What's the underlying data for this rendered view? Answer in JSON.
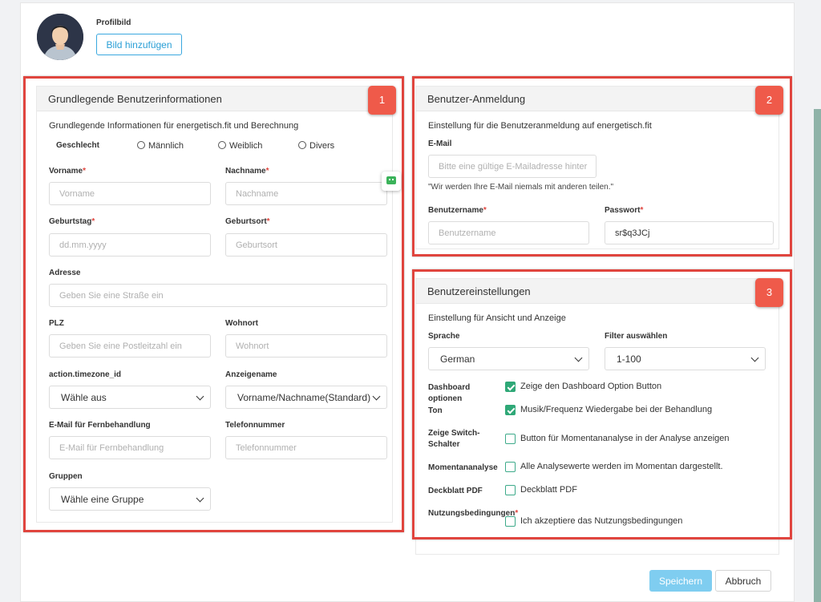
{
  "profile": {
    "label": "Profilbild",
    "add_button": "Bild hinzufügen"
  },
  "section1": {
    "badge": "1",
    "title": "Grundlegende Benutzerinformationen",
    "description": "Grundlegende Informationen für energetisch.fit und Berechnung",
    "gender": {
      "label": "Geschlecht",
      "options": [
        "Männlich",
        "Weiblich",
        "Divers"
      ]
    },
    "vorname": {
      "label": "Vorname",
      "placeholder": "Vorname"
    },
    "nachname": {
      "label": "Nachname",
      "placeholder": "Nachname"
    },
    "geburtstag": {
      "label": "Geburtstag",
      "placeholder": "dd.mm.yyyy"
    },
    "geburtsort": {
      "label": "Geburtsort",
      "placeholder": "Geburtsort"
    },
    "adresse": {
      "label": "Adresse",
      "placeholder": "Geben Sie eine Straße ein"
    },
    "plz": {
      "label": "PLZ",
      "placeholder": "Geben Sie eine Postleitzahl ein"
    },
    "wohnort": {
      "label": "Wohnort",
      "placeholder": "Wohnort"
    },
    "timezone": {
      "label": "action.timezone_id",
      "value": "Wähle aus"
    },
    "anzeigename": {
      "label": "Anzeigename",
      "value": "Vorname/Nachname(Standard)"
    },
    "fernbehandlung": {
      "label": "E-Mail für Fernbehandlung",
      "placeholder": "E-Mail für Fernbehandlung"
    },
    "telefon": {
      "label": "Telefonnummer",
      "placeholder": "Telefonnummer"
    },
    "gruppen": {
      "label": "Gruppen",
      "value": "Wähle eine Gruppe"
    }
  },
  "section2": {
    "badge": "2",
    "title": "Benutzer-Anmeldung",
    "description": "Einstellung für die Benutzeranmeldung auf energetisch.fit",
    "email": {
      "label": "E-Mail",
      "placeholder": "Bitte eine gültige E-Mailadresse hinter",
      "note": "\"Wir werden Ihre E-Mail niemals mit anderen teilen.\""
    },
    "benutzername": {
      "label": "Benutzername",
      "placeholder": "Benutzername"
    },
    "passwort": {
      "label": "Passwort",
      "value": "sr$q3JCj"
    }
  },
  "section3": {
    "badge": "3",
    "title": "Benutzereinstellungen",
    "description": "Einstellung für Ansicht und Anzeige",
    "sprache": {
      "label": "Sprache",
      "value": "German"
    },
    "filter": {
      "label": "Filter auswählen",
      "value": "1-100"
    },
    "settings": [
      {
        "label": "Dashboard optionen",
        "text": "Zeige den Dashboard Option Button",
        "checked": true
      },
      {
        "label": "Ton",
        "text": "Musik/Frequenz Wiedergabe bei der Behandlung",
        "checked": true
      },
      {
        "label": "Zeige Switch-Schalter",
        "text": "Button für Momentananalyse in der Analyse anzeigen",
        "checked": false
      },
      {
        "label": "Momentananalyse",
        "text": "Alle Analysewerte werden im Momentan dargestellt.",
        "checked": false
      },
      {
        "label": "Deckblatt PDF",
        "text": "Deckblatt PDF",
        "checked": false
      },
      {
        "label": "Nutzungsbedingungen",
        "text": "Ich akzeptiere das Nutzungsbedingungen",
        "checked": false
      }
    ]
  },
  "actions": {
    "save": "Speichern",
    "cancel": "Abbruch"
  },
  "colors": {
    "accent": "#2a9fd6",
    "highlight": "#e0453e",
    "check": "#2fa877"
  }
}
